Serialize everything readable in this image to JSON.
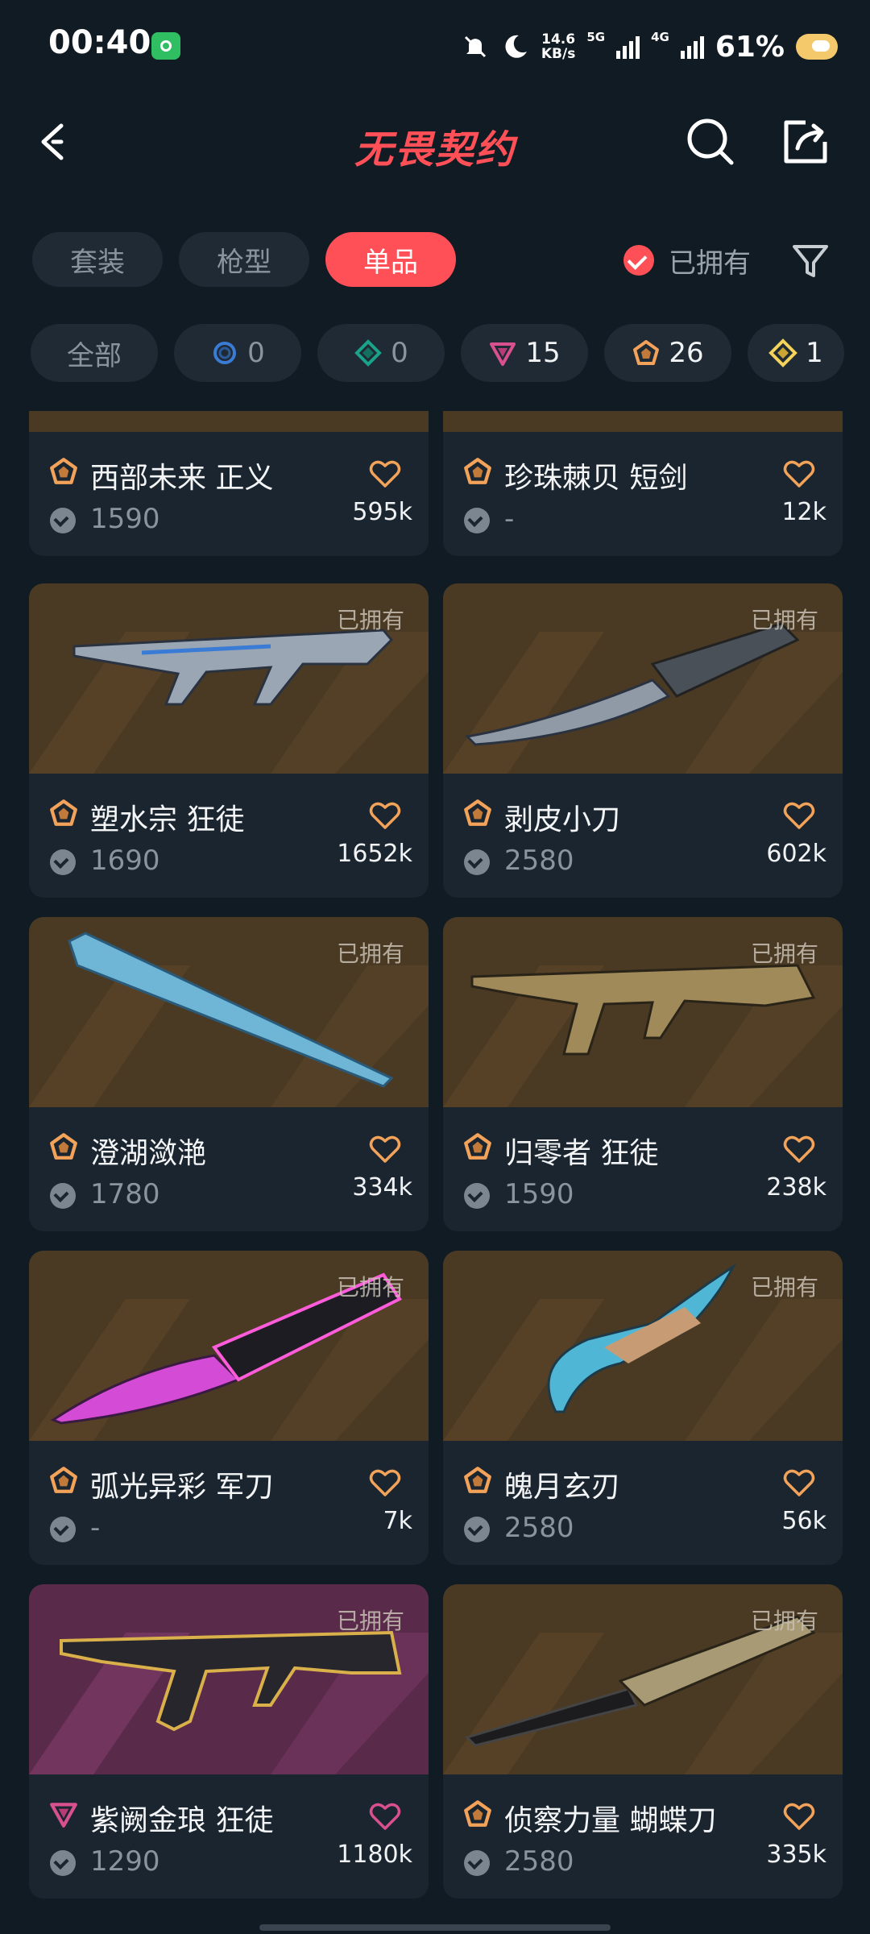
{
  "status_bar": {
    "time": "00:40",
    "speed_value": "14.6",
    "speed_unit": "KB/s",
    "net1": "5G",
    "net2": "4G",
    "battery": "61%"
  },
  "header": {
    "title": "无畏契约"
  },
  "tabs": [
    {
      "label": "套装",
      "active": false
    },
    {
      "label": "枪型",
      "active": false
    },
    {
      "label": "单品",
      "active": true
    }
  ],
  "owned_filter": {
    "label": "已拥有",
    "checked": true
  },
  "rarity_filters": [
    {
      "label": "全部"
    },
    {
      "count": "0",
      "icon": "select-tier-icon",
      "color": "#3a7bd5"
    },
    {
      "count": "0",
      "icon": "deluxe-tier-icon",
      "color": "#1aa38a"
    },
    {
      "count": "15",
      "icon": "premium-tier-icon",
      "color": "#d9508f"
    },
    {
      "count": "26",
      "icon": "exclusive-tier-icon",
      "color": "#f3a25a"
    },
    {
      "count": "1",
      "icon": "ultra-tier-icon",
      "color": "#f5d35b"
    }
  ],
  "items": [
    {
      "name": "西部未来 正义",
      "price": "1590",
      "likes": "595k",
      "tier": "exclusive",
      "owned": "",
      "fav_color": "#f3a25a"
    },
    {
      "name": "珍珠棘贝 短剑",
      "price": "-",
      "likes": "12k",
      "tier": "exclusive",
      "owned": "",
      "fav_color": "#f3a25a"
    },
    {
      "name": "塑水宗 狂徒",
      "price": "1690",
      "likes": "1652k",
      "tier": "exclusive",
      "owned": "已拥有",
      "fav_color": "#f3a25a"
    },
    {
      "name": "剥皮小刀",
      "price": "2580",
      "likes": "602k",
      "tier": "exclusive",
      "owned": "已拥有",
      "fav_color": "#f3a25a"
    },
    {
      "name": "澄湖潋滟",
      "price": "1780",
      "likes": "334k",
      "tier": "exclusive",
      "owned": "已拥有",
      "fav_color": "#f3a25a"
    },
    {
      "name": "归零者 狂徒",
      "price": "1590",
      "likes": "238k",
      "tier": "exclusive",
      "owned": "已拥有",
      "fav_color": "#f3a25a"
    },
    {
      "name": "弧光异彩 军刀",
      "price": "-",
      "likes": "7k",
      "tier": "exclusive",
      "owned": "已拥有",
      "fav_color": "#f3a25a"
    },
    {
      "name": "魄月玄刃",
      "price": "2580",
      "likes": "56k",
      "tier": "exclusive",
      "owned": "已拥有",
      "fav_color": "#f3a25a"
    },
    {
      "name": "紫阙金琅 狂徒",
      "price": "1290",
      "likes": "1180k",
      "tier": "premium",
      "owned": "已拥有",
      "fav_color": "#d9508f"
    },
    {
      "name": "侦察力量 蝴蝶刀",
      "price": "2580",
      "likes": "335k",
      "tier": "exclusive",
      "owned": "已拥有",
      "fav_color": "#f3a25a"
    }
  ]
}
